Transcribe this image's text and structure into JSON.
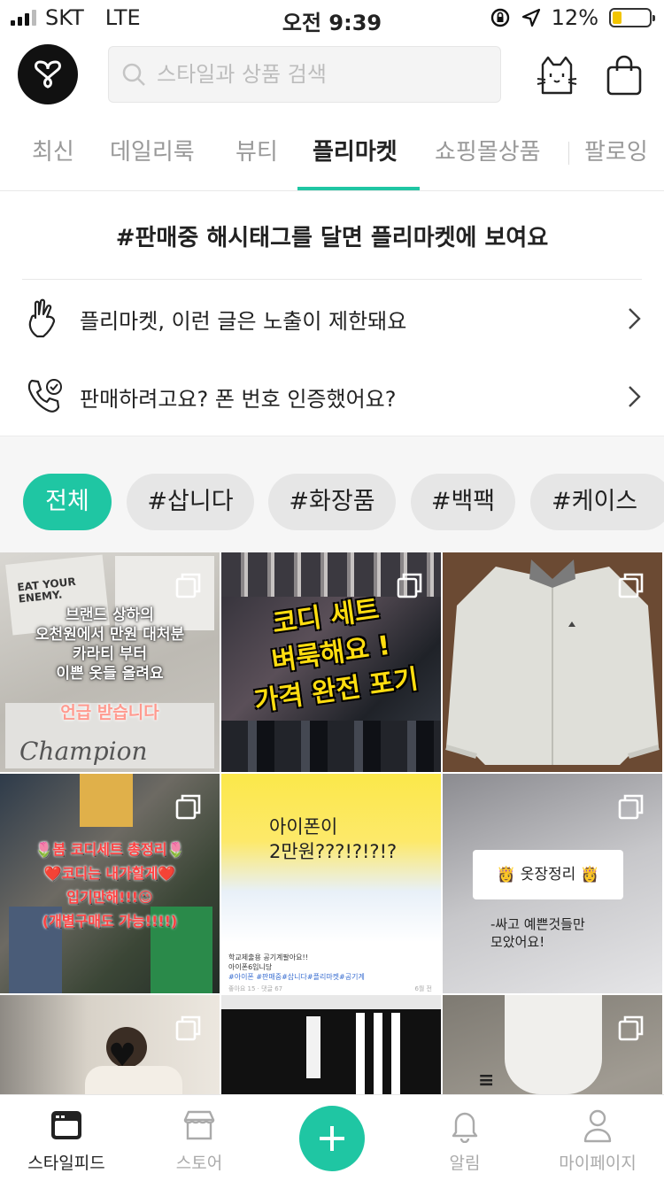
{
  "status_bar": {
    "carrier": "SKT",
    "network": "LTE",
    "time": "오전 9:39",
    "battery": "12%",
    "battery_level": 0.12
  },
  "header": {
    "search_placeholder": "스타일과 상품 검색"
  },
  "tabs": [
    {
      "label": "최신",
      "active": false
    },
    {
      "label": "데일리룩",
      "active": false
    },
    {
      "label": "뷰티",
      "active": false
    },
    {
      "label": "플리마켓",
      "active": true
    },
    {
      "label": "쇼핑몰상품",
      "active": false
    },
    {
      "label": "팔로잉",
      "active": false
    }
  ],
  "notice": {
    "title": "#판매중 해시태그를 달면 플리마켓에 보여요",
    "rows": [
      {
        "label": "플리마켓, 이런 글은 노출이 제한돼요",
        "icon": "hand-icon"
      },
      {
        "label": "판매하려고요? 폰 번호 인증했어요?",
        "icon": "phone-check-icon"
      }
    ]
  },
  "chips": [
    {
      "label": "전체",
      "active": true
    },
    {
      "label": "#삽니다",
      "active": false
    },
    {
      "label": "#화장품",
      "active": false
    },
    {
      "label": "#백팩",
      "active": false
    },
    {
      "label": "#케이스",
      "active": false
    }
  ],
  "posts": [
    {
      "lines": [
        "브랜드 상하의",
        "오천원에서 만원 대처분",
        "카라티 부터",
        "이쁜 옷들 올려요"
      ],
      "highlight": "언급 받습니다",
      "shirt_texts": [
        "EAT YOUR ENEMY.",
        "Champion"
      ]
    },
    {
      "lines": [
        "코디 세트",
        "벼룩해요 !",
        "가격 완전 포기"
      ]
    },
    {
      "lines": []
    },
    {
      "lines": [
        "🌷봄 코디세트 총정리🌷",
        "❤️코디는 내가할게❤️",
        "입기만해!!!😉",
        "(개별구매도 가능!!!!)"
      ]
    },
    {
      "title": "아이폰이",
      "title2": "2만원???!?!?!?",
      "caption": "학교제출용 공기계팔아요!!",
      "caption2": "아이폰6입니당",
      "tags": "#아이폰 #판매중#삽니다#플리마켓#공기계",
      "meta": "좋아요 15 · 댓글 67",
      "time": "6월 전"
    },
    {
      "card": "👸 옷장정리 👸",
      "lines": [
        "-싸고 예쁜것들만",
        "모았어요!"
      ]
    },
    {
      "lines": []
    },
    {
      "lines": []
    },
    {
      "lines": []
    }
  ],
  "bottom_nav": [
    {
      "label": "스타일피드",
      "active": true,
      "icon": "feed-icon"
    },
    {
      "label": "스토어",
      "active": false,
      "icon": "store-icon"
    },
    {
      "label": "",
      "active": false,
      "icon": "plus-icon"
    },
    {
      "label": "알림",
      "active": false,
      "icon": "bell-icon"
    },
    {
      "label": "마이페이지",
      "active": false,
      "icon": "person-icon"
    }
  ],
  "colors": {
    "accent": "#1fc6a3",
    "chip_bg": "#e6e6e6",
    "battery": "#f2c500"
  }
}
